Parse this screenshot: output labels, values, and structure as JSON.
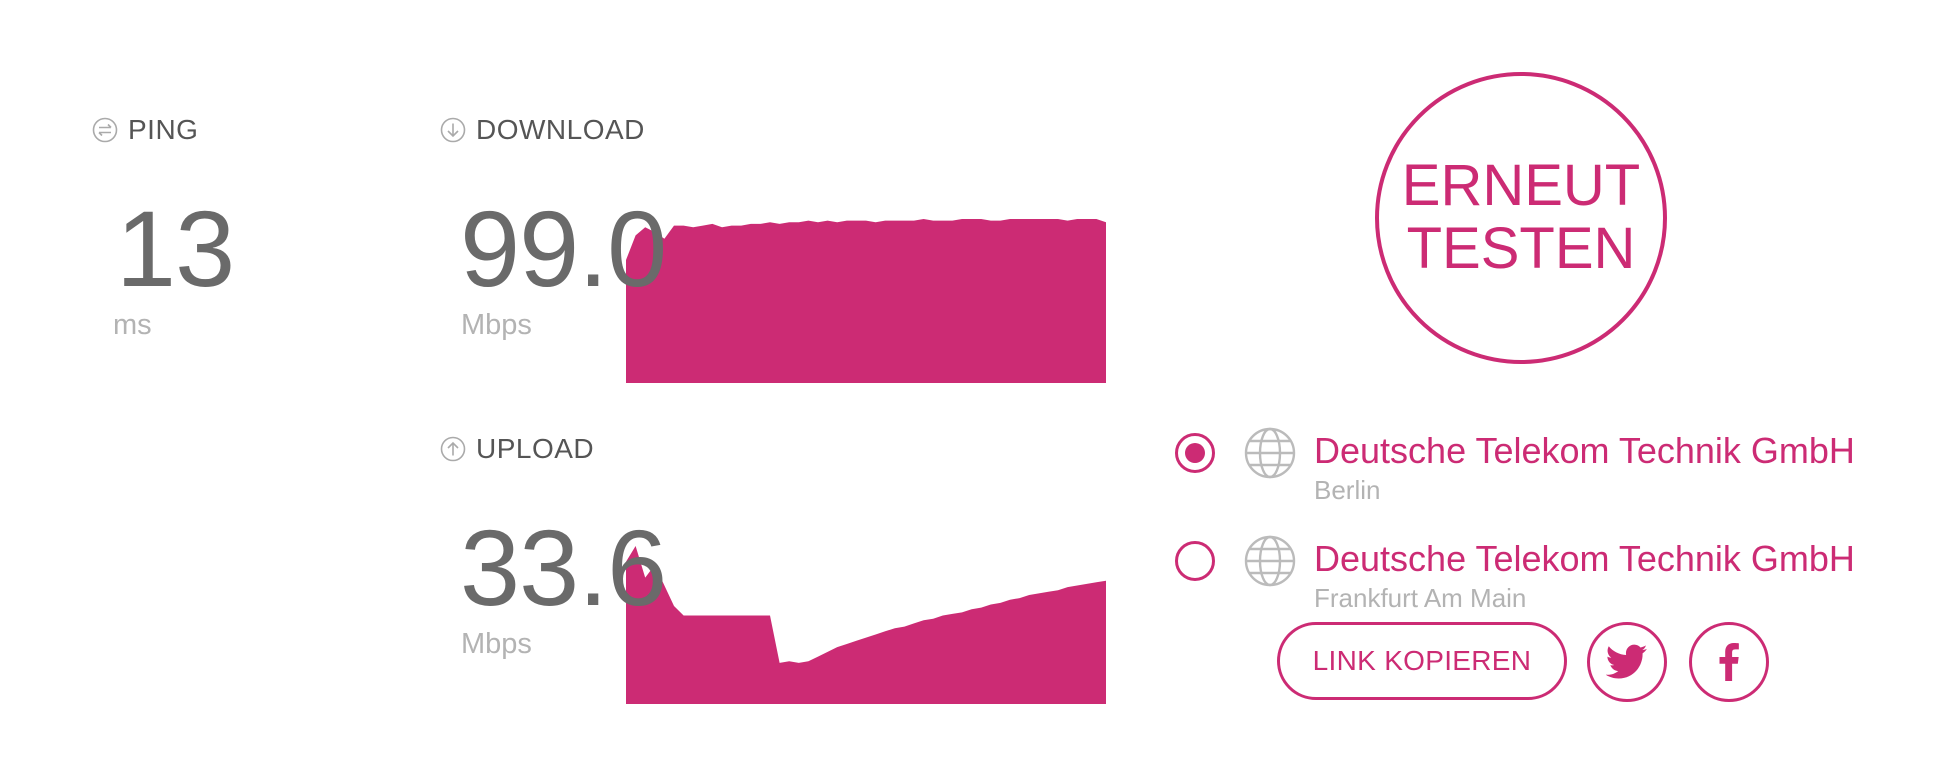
{
  "colors": {
    "accent": "#cc2b74",
    "value": "#6a6a6a",
    "muted": "#b3b3b3"
  },
  "ping": {
    "label": "PING",
    "icon": "swap-arrows-icon",
    "value": "13",
    "unit": "ms"
  },
  "download": {
    "label": "DOWNLOAD",
    "icon": "arrow-down-circle-icon",
    "value": "99.0",
    "unit": "Mbps",
    "series": [
      75,
      90,
      95,
      92,
      88,
      96,
      96,
      95,
      96,
      97,
      95,
      96,
      96,
      97,
      97,
      98,
      97,
      98,
      98,
      99,
      98,
      99,
      98,
      99,
      99,
      99,
      98,
      99,
      99,
      99,
      99,
      100,
      99,
      99,
      99,
      100,
      100,
      100,
      99,
      99,
      100,
      100,
      100,
      100,
      100,
      100,
      99,
      100,
      100,
      100,
      98
    ]
  },
  "upload": {
    "label": "UPLOAD",
    "icon": "arrow-up-circle-icon",
    "value": "33.6",
    "unit": "Mbps",
    "series": [
      90,
      100,
      80,
      88,
      75,
      62,
      56,
      56,
      56,
      56,
      56,
      56,
      56,
      56,
      56,
      56,
      26,
      27,
      26,
      27,
      30,
      33,
      36,
      38,
      40,
      42,
      44,
      46,
      48,
      49,
      51,
      53,
      54,
      56,
      57,
      58,
      60,
      61,
      63,
      64,
      66,
      67,
      69,
      70,
      71,
      72,
      74,
      75,
      76,
      77,
      78
    ]
  },
  "retest": {
    "line1": "ERNEUT",
    "line2": "TESTEN"
  },
  "servers": [
    {
      "name": "Deutsche Telekom Technik GmbH",
      "city": "Berlin",
      "selected": true
    },
    {
      "name": "Deutsche Telekom Technik GmbH",
      "city": "Frankfurt Am Main",
      "selected": false
    }
  ],
  "share": {
    "copy_link": "LINK KOPIEREN",
    "twitter_icon": "twitter-icon",
    "facebook_icon": "facebook-icon"
  }
}
